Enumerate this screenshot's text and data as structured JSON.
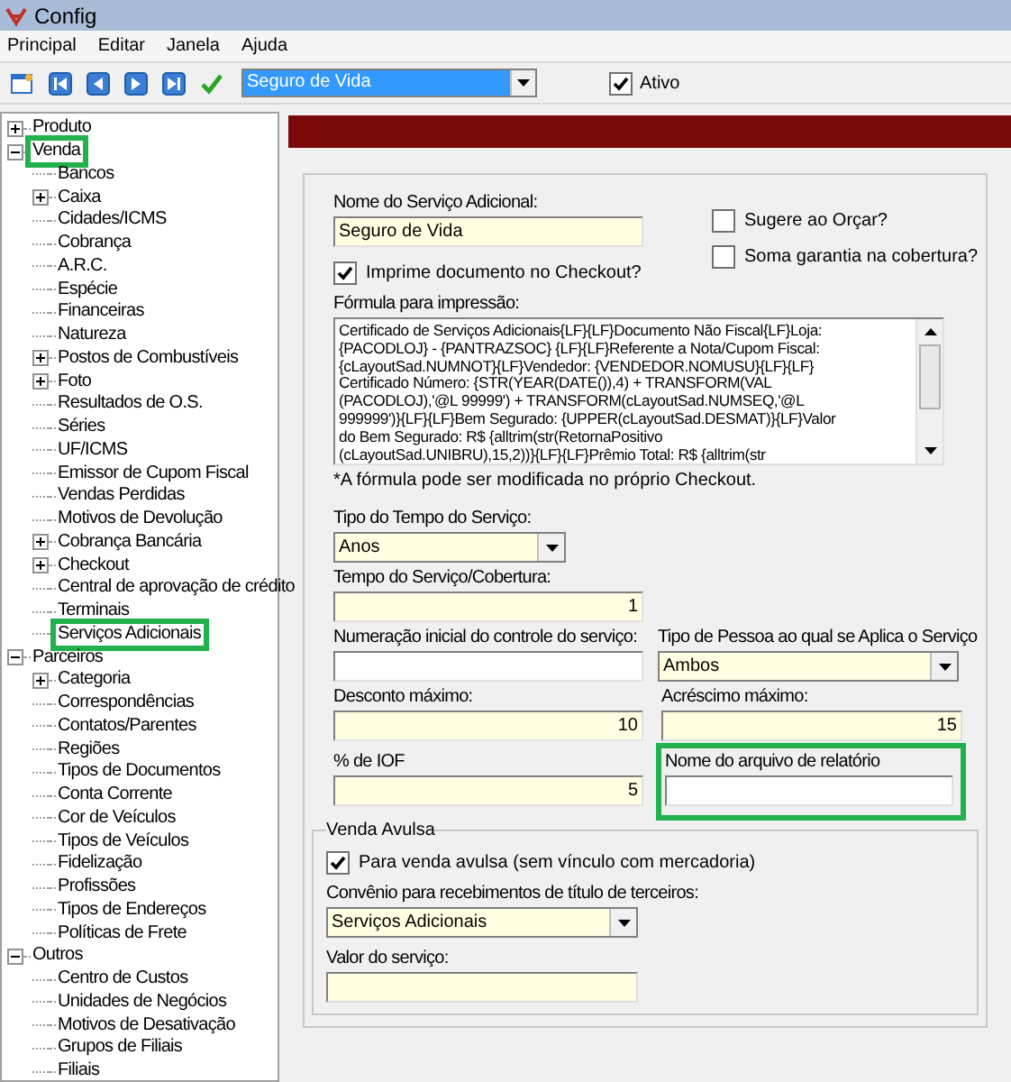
{
  "window": {
    "title": "Config"
  },
  "menu": [
    {
      "label": "Principal"
    },
    {
      "label": "Editar"
    },
    {
      "label": "Janela"
    },
    {
      "label": "Ajuda"
    }
  ],
  "toolbar": {
    "record_select": {
      "value": "Seguro de Vida"
    },
    "active": {
      "label": "Ativo",
      "checked": true
    }
  },
  "tree": [
    {
      "label": "Produto",
      "expanded": false,
      "highlighted": false
    },
    {
      "label": "Venda",
      "expanded": true,
      "highlighted": true,
      "children": [
        {
          "label": "Bancos",
          "highlighted": false
        },
        {
          "label": "Caixa",
          "expanded": false,
          "highlighted": false
        },
        {
          "label": "Cidades/ICMS",
          "highlighted": false
        },
        {
          "label": "Cobrança",
          "highlighted": false
        },
        {
          "label": "A.R.C.",
          "highlighted": false
        },
        {
          "label": "Espécie",
          "highlighted": false
        },
        {
          "label": "Financeiras",
          "highlighted": false
        },
        {
          "label": "Natureza",
          "highlighted": false
        },
        {
          "label": "Postos de Combustíveis",
          "expanded": false,
          "highlighted": false
        },
        {
          "label": "Foto",
          "expanded": false,
          "highlighted": false
        },
        {
          "label": "Resultados de O.S.",
          "highlighted": false
        },
        {
          "label": "Séries",
          "highlighted": false
        },
        {
          "label": "UF/ICMS",
          "highlighted": false
        },
        {
          "label": "Emissor de Cupom Fiscal",
          "highlighted": false
        },
        {
          "label": "Vendas Perdidas",
          "highlighted": false
        },
        {
          "label": "Motivos de Devolução",
          "highlighted": false
        },
        {
          "label": "Cobrança Bancária",
          "expanded": false,
          "highlighted": false
        },
        {
          "label": "Checkout",
          "expanded": false,
          "highlighted": false
        },
        {
          "label": "Central de aprovação de crédito",
          "highlighted": false
        },
        {
          "label": "Terminais",
          "highlighted": false
        },
        {
          "label": "Serviços Adicionais",
          "highlighted": true
        }
      ]
    },
    {
      "label": "Parceiros",
      "expanded": true,
      "highlighted": false,
      "children": [
        {
          "label": "Categoria",
          "expanded": false,
          "highlighted": false
        },
        {
          "label": "Correspondências",
          "highlighted": false
        },
        {
          "label": "Contatos/Parentes",
          "highlighted": false
        },
        {
          "label": "Regiões",
          "highlighted": false
        },
        {
          "label": "Tipos de Documentos",
          "highlighted": false
        },
        {
          "label": "Conta Corrente",
          "highlighted": false
        },
        {
          "label": "Cor de Veículos",
          "highlighted": false
        },
        {
          "label": "Tipos de Veículos",
          "highlighted": false
        },
        {
          "label": "Fidelização",
          "highlighted": false
        },
        {
          "label": "Profissões",
          "highlighted": false
        },
        {
          "label": "Tipos de Endereços",
          "highlighted": false
        },
        {
          "label": "Políticas de Frete",
          "highlighted": false
        }
      ]
    },
    {
      "label": "Outros",
      "expanded": true,
      "highlighted": false,
      "children": [
        {
          "label": "Centro de Custos",
          "highlighted": false
        },
        {
          "label": "Unidades de Negócios",
          "highlighted": false
        },
        {
          "label": "Motivos de Desativação",
          "highlighted": false
        },
        {
          "label": "Grupos de Filiais",
          "highlighted": false
        },
        {
          "label": "Filiais",
          "highlighted": false
        }
      ]
    }
  ],
  "form": {
    "name": {
      "label": "Nome do Serviço Adicional:",
      "value": "Seguro de Vida"
    },
    "suggest_quote": {
      "label": "Sugere ao Orçar?",
      "checked": false
    },
    "sum_guarantee": {
      "label": "Soma garantia na cobertura?",
      "checked": false
    },
    "print_document": {
      "label": "Imprime documento no Checkout?",
      "checked": true
    },
    "formula": {
      "label": "Fórmula para impressão:",
      "lines": [
        "Certificado de Serviços Adicionais{LF}{LF}Documento Não Fiscal{LF}Loja:",
        "{PACODLOJ} - {PANTRAZSOC} {LF}{LF}Referente a Nota/Cupom Fiscal:",
        "{cLayoutSad.NUMNOT}{LF}Vendedor: {VENDEDOR.NOMUSU}{LF}{LF}",
        "Certificado Número: {STR(YEAR(DATE()),4) + TRANSFORM(VAL",
        "(PACODLOJ),'@L 99999') + TRANSFORM(cLayoutSad.NUMSEQ,'@L",
        "999999')}{LF}{LF}Bem Segurado: {UPPER(cLayoutSad.DESMAT)}{LF}Valor",
        "do Bem Segurado: R$ {alltrim(str(RetornaPositivo",
        "(cLayoutSad.UNIBRU),15,2))}{LF}{LF}Prêmio Total: R$ {alltrim(str"
      ]
    },
    "formula_note": "*A fórmula pode ser modificada no próprio Checkout.",
    "time_type": {
      "label": "Tipo do Tempo do Serviço:",
      "value": "Anos"
    },
    "time": {
      "label": "Tempo do Serviço/Cobertura:",
      "value": "1"
    },
    "initial_number": {
      "label": "Numeração inicial do controle do serviço:"
    },
    "person_type": {
      "label": "Tipo de Pessoa ao qual se Aplica o Serviço",
      "value": "Ambos"
    },
    "max_discount": {
      "label": "Desconto máximo:",
      "value": "10"
    },
    "max_increase": {
      "label": "Acréscimo máximo:",
      "value": "15"
    },
    "iof": {
      "label": "% de IOF",
      "value": "5"
    },
    "report_file": {
      "label": "Nome do arquivo de relatório",
      "highlighted": true
    },
    "standalone": {
      "title": "Venda Avulsa",
      "standalone_sale": {
        "label": "Para venda avulsa (sem vínculo com mercadoria)",
        "checked": true
      },
      "agreement": {
        "label": "Convênio para recebimentos de título de terceiros:",
        "value": "Serviços Adicionais"
      },
      "service_value": {
        "label": "Valor do serviço:"
      }
    }
  }
}
